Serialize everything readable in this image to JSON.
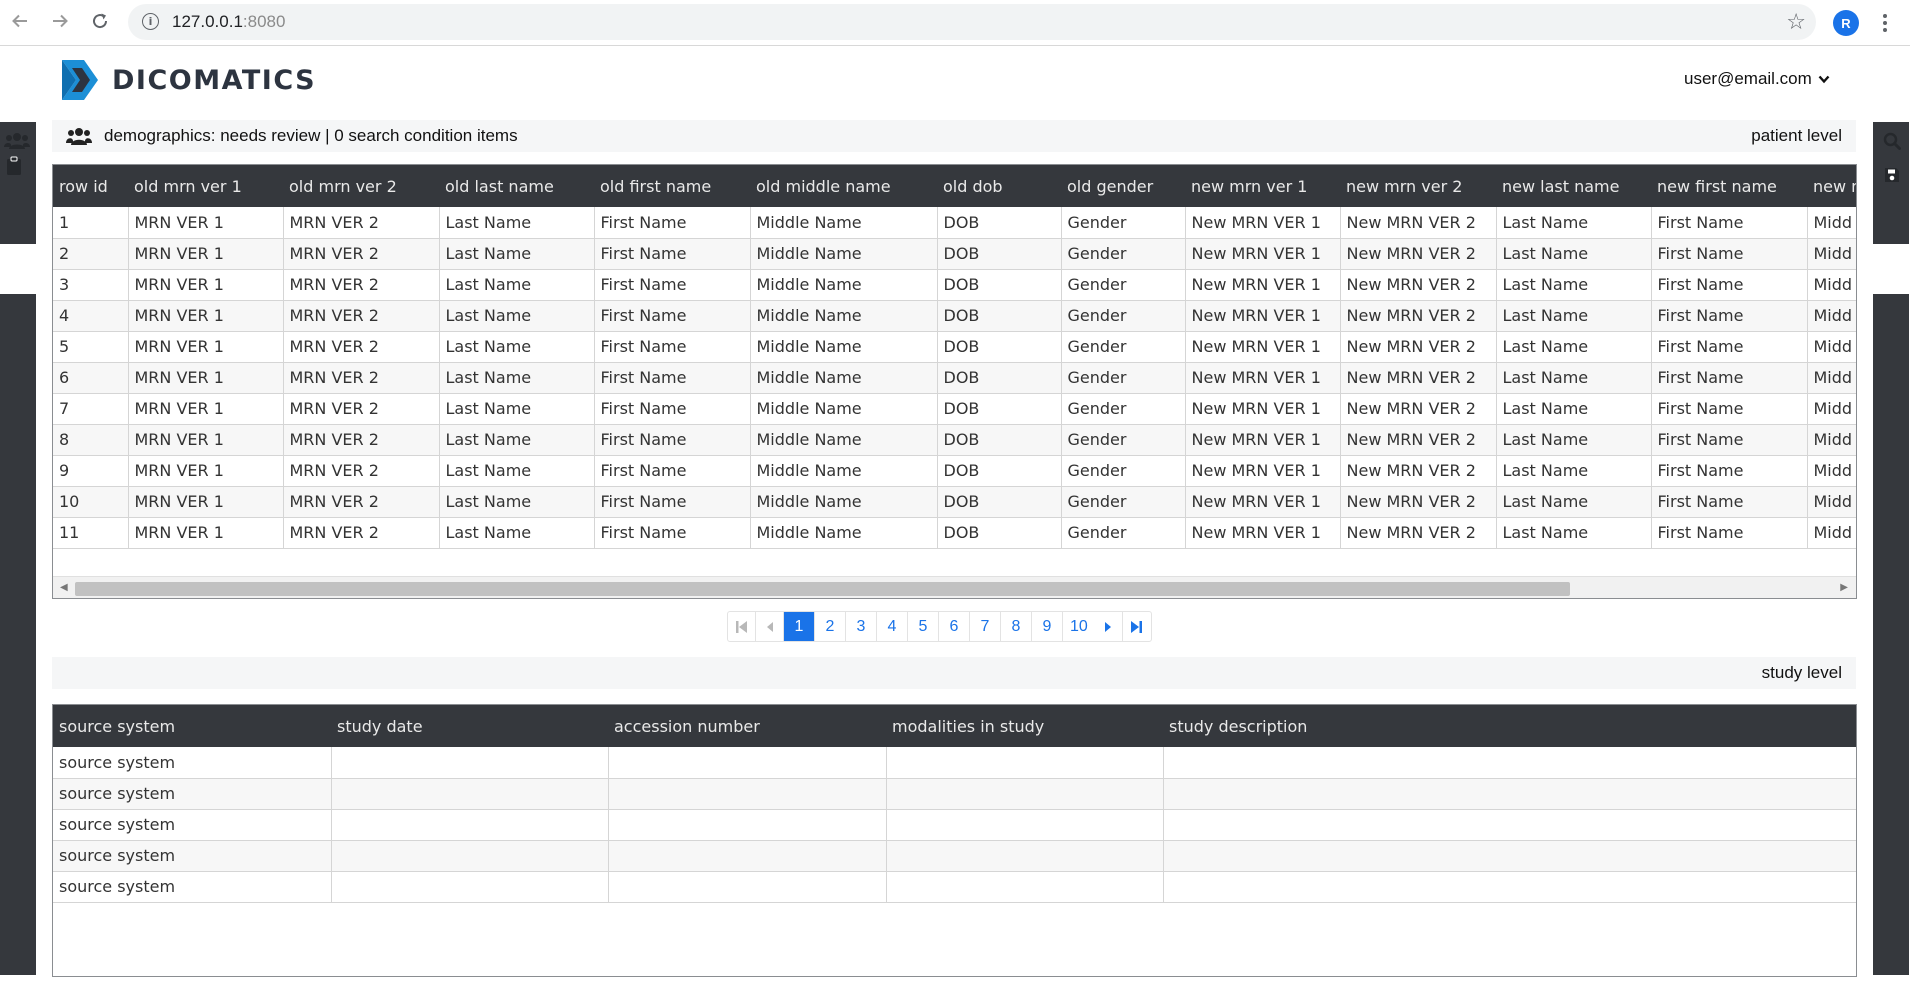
{
  "browser": {
    "url_host": "127.0.0.1",
    "url_port": ":8080",
    "profile_initial": "R"
  },
  "app": {
    "logo_text": "DICOMATICS",
    "user_email": "user@email.com"
  },
  "patient_section": {
    "title": "demographics: needs review | 0 search condition items",
    "level_label": "patient level",
    "columns": [
      "row id",
      "old mrn ver 1",
      "old mrn ver 2",
      "old last name",
      "old first name",
      "old middle name",
      "old dob",
      "old gender",
      "new mrn ver 1",
      "new mrn ver 2",
      "new last name",
      "new first name",
      "new m"
    ],
    "rows": [
      [
        "1",
        "MRN VER 1",
        "MRN VER 2",
        "Last Name",
        "First Name",
        "Middle Name",
        "DOB",
        "Gender",
        "New MRN VER 1",
        "New MRN VER 2",
        "Last Name",
        "First Name",
        "Midd"
      ],
      [
        "2",
        "MRN VER 1",
        "MRN VER 2",
        "Last Name",
        "First Name",
        "Middle Name",
        "DOB",
        "Gender",
        "New MRN VER 1",
        "New MRN VER 2",
        "Last Name",
        "First Name",
        "Midd"
      ],
      [
        "3",
        "MRN VER 1",
        "MRN VER 2",
        "Last Name",
        "First Name",
        "Middle Name",
        "DOB",
        "Gender",
        "New MRN VER 1",
        "New MRN VER 2",
        "Last Name",
        "First Name",
        "Midd"
      ],
      [
        "4",
        "MRN VER 1",
        "MRN VER 2",
        "Last Name",
        "First Name",
        "Middle Name",
        "DOB",
        "Gender",
        "New MRN VER 1",
        "New MRN VER 2",
        "Last Name",
        "First Name",
        "Midd"
      ],
      [
        "5",
        "MRN VER 1",
        "MRN VER 2",
        "Last Name",
        "First Name",
        "Middle Name",
        "DOB",
        "Gender",
        "New MRN VER 1",
        "New MRN VER 2",
        "Last Name",
        "First Name",
        "Midd"
      ],
      [
        "6",
        "MRN VER 1",
        "MRN VER 2",
        "Last Name",
        "First Name",
        "Middle Name",
        "DOB",
        "Gender",
        "New MRN VER 1",
        "New MRN VER 2",
        "Last Name",
        "First Name",
        "Midd"
      ],
      [
        "7",
        "MRN VER 1",
        "MRN VER 2",
        "Last Name",
        "First Name",
        "Middle Name",
        "DOB",
        "Gender",
        "New MRN VER 1",
        "New MRN VER 2",
        "Last Name",
        "First Name",
        "Midd"
      ],
      [
        "8",
        "MRN VER 1",
        "MRN VER 2",
        "Last Name",
        "First Name",
        "Middle Name",
        "DOB",
        "Gender",
        "New MRN VER 1",
        "New MRN VER 2",
        "Last Name",
        "First Name",
        "Midd"
      ],
      [
        "9",
        "MRN VER 1",
        "MRN VER 2",
        "Last Name",
        "First Name",
        "Middle Name",
        "DOB",
        "Gender",
        "New MRN VER 1",
        "New MRN VER 2",
        "Last Name",
        "First Name",
        "Midd"
      ],
      [
        "10",
        "MRN VER 1",
        "MRN VER 2",
        "Last Name",
        "First Name",
        "Middle Name",
        "DOB",
        "Gender",
        "New MRN VER 1",
        "New MRN VER 2",
        "Last Name",
        "First Name",
        "Midd"
      ],
      [
        "11",
        "MRN VER 1",
        "MRN VER 2",
        "Last Name",
        "First Name",
        "Middle Name",
        "DOB",
        "Gender",
        "New MRN VER 1",
        "New MRN VER 2",
        "Last Name",
        "First Name",
        "Midd"
      ]
    ],
    "horizontal_scroll_fraction": 0.0
  },
  "pagination": {
    "pages": [
      "1",
      "2",
      "3",
      "4",
      "5",
      "6",
      "7",
      "8",
      "9",
      "10"
    ],
    "current_page": "1",
    "first_icon": "first-page-icon",
    "prev_icon": "prev-page-icon",
    "next_icon": "next-page-icon",
    "last_icon": "last-page-icon"
  },
  "study_section": {
    "level_label": "study level",
    "columns": [
      "source system",
      "study date",
      "accession number",
      "modalities in study",
      "study description"
    ],
    "rows": [
      [
        "source system",
        "",
        "",
        "",
        ""
      ],
      [
        "source system",
        "",
        "",
        "",
        ""
      ],
      [
        "source system",
        "",
        "",
        "",
        ""
      ],
      [
        "source system",
        "",
        "",
        "",
        ""
      ],
      [
        "source system",
        "",
        "",
        "",
        ""
      ]
    ]
  },
  "icons": {
    "left_rail": [
      "users-icon",
      "clipboard-icon"
    ],
    "right_rail": [
      "search-icon",
      "save-icon"
    ]
  },
  "colors": {
    "accent": "#1a73e8",
    "header_dark": "#35383d",
    "logo_dark": "#2d3440",
    "logo_blue": "#1c8fd6"
  }
}
